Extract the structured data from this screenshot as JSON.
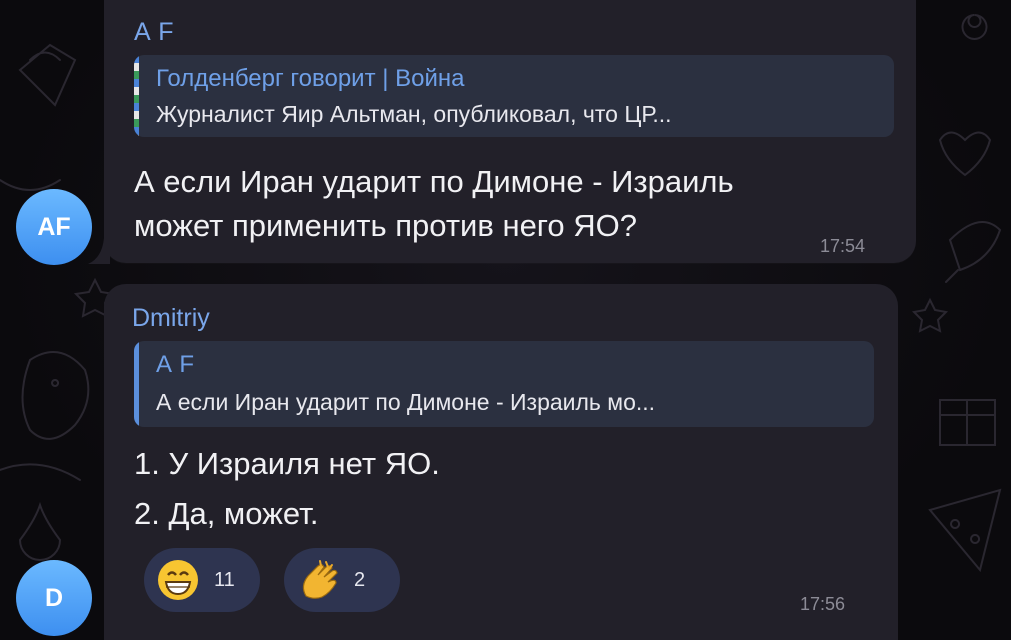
{
  "messages": [
    {
      "sender": "A F",
      "avatar_initials": "AF",
      "reply": {
        "title": "Голденберг говорит | Война",
        "text": "Журналист Яир Альтман, опубликовал, что ЦР..."
      },
      "lines": [
        "А если Иран ударит по Димоне - Израиль",
        "может применить против него ЯО?"
      ],
      "time": "17:54"
    },
    {
      "sender": "Dmitriy",
      "avatar_initials": "D",
      "reply": {
        "title": "A F",
        "text": "А если Иран ударит по Димоне - Израиль мо..."
      },
      "lines": [
        "1. У Израиля нет ЯО.",
        "2. Да, может."
      ],
      "reactions": [
        {
          "emoji": "grinning-face-with-smiling-eyes",
          "count": "11"
        },
        {
          "emoji": "clapping-hands",
          "count": "2"
        }
      ],
      "time": "17:56"
    }
  ],
  "colors": {
    "background": "#0d0c10",
    "bubble": "#222029",
    "sender_name": "#7aa6ea",
    "quote_background": "#2b3040",
    "avatar": "#4a9ef5",
    "reaction_background": "#2e3450"
  }
}
